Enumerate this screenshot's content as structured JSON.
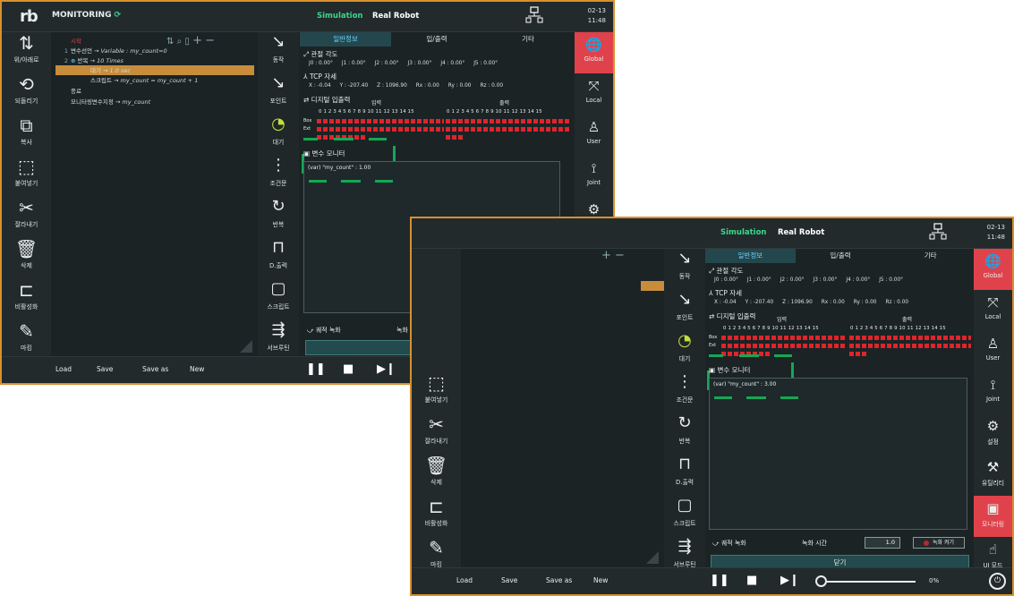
{
  "header": {
    "logo": "rb",
    "title": "MONITORING",
    "mode_sim": "Simulation",
    "mode_real": "Real Robot",
    "date": "02-13",
    "time": "11:48"
  },
  "left_toolbar": [
    {
      "icon": "move-up-down-icon",
      "label": "위/아래로"
    },
    {
      "icon": "restore-icon",
      "label": "되돌리기"
    },
    {
      "icon": "copy-icon",
      "label": "복사"
    },
    {
      "icon": "paste-icon",
      "label": "붙여넣기"
    },
    {
      "icon": "cut-icon",
      "label": "잘라내기"
    },
    {
      "icon": "delete-icon",
      "label": "삭제"
    },
    {
      "icon": "disable-icon",
      "label": "비활성화"
    },
    {
      "icon": "mark-icon",
      "label": "마킹"
    }
  ],
  "program_tree": [
    {
      "num": "",
      "text": "시작"
    },
    {
      "num": "1",
      "text": "변수선언 → ",
      "italic": "Variable : my_count=0"
    },
    {
      "num": "2",
      "text": "반복 → ",
      "italic": "10 Times"
    },
    {
      "num": "",
      "text": "대기 → ",
      "italic": "1.0 sec"
    },
    {
      "num": "",
      "text": "스크립트 → ",
      "italic": "my_count = my_count + 1"
    },
    {
      "num": "",
      "text": "종료"
    },
    {
      "num": "",
      "text": "모니터링변수지정 → ",
      "italic": "my_count"
    }
  ],
  "command_bar": [
    {
      "icon": "move-icon",
      "label": "동작"
    },
    {
      "icon": "point-icon",
      "label": "포인트"
    },
    {
      "icon": "wait-icon",
      "label": "대기"
    },
    {
      "icon": "condition-icon",
      "label": "조건문"
    },
    {
      "icon": "repeat-icon",
      "label": "반복"
    },
    {
      "icon": "digital-out-icon",
      "label": "D.출력"
    },
    {
      "icon": "script-icon",
      "label": "스크립트"
    },
    {
      "icon": "subroutine-icon",
      "label": "서브루틴"
    }
  ],
  "monitor_panel": {
    "tabs": [
      "일반정보",
      "입/출력",
      "기타"
    ],
    "joint_title": "관절 각도",
    "joints": [
      "J0 : 0.00°",
      "J1 : 0.00°",
      "J2 : 0.00°",
      "J3 : 0.00°",
      "J4 : 0.00°",
      "J5 : 0.00°"
    ],
    "tcp_title": "TCP 자세",
    "tcp": [
      "X : -0.04",
      "Y : -207.40",
      "Z : 1096.90",
      "Rx : 0.00",
      "Ry : 0.00",
      "Rz : 0.00"
    ],
    "io_title": "디지털 입출력",
    "io_in": "입력",
    "io_out": "출력",
    "io_numbers": "0 1 2 3 4 5 6 7 8 9 10 11 12 13 14 15",
    "io_box": "Box",
    "io_ext": "Ext",
    "var_monitor_title": "변수 모니터",
    "var_value_w1": "(var) \"my_count\" : 1.00",
    "var_value_w2": "(var) \"my_count\" : 3.00",
    "record_title": "궤적 녹화",
    "record_time_label": "녹화 시간",
    "record_time_value": "1.0",
    "record_button": "녹화 켜기",
    "close_button": "닫기"
  },
  "right_toolbar": [
    {
      "icon": "global-icon",
      "label": "Global"
    },
    {
      "icon": "local-icon",
      "label": "Local"
    },
    {
      "icon": "user-icon",
      "label": "User"
    },
    {
      "icon": "joint-icon",
      "label": "Joint"
    },
    {
      "icon": "settings-icon",
      "label": "설정"
    },
    {
      "icon": "utility-icon",
      "label": "유틸리티"
    },
    {
      "icon": "monitoring-icon",
      "label": "모니터링"
    },
    {
      "icon": "ui-mode-icon",
      "label": "UI 모드"
    }
  ],
  "bottom_bar": {
    "load": "Load",
    "save": "Save",
    "save_as": "Save as",
    "new": "New",
    "progress": "0%",
    "progress_value": 0
  },
  "colors": {
    "accent_orange": "#d9902e",
    "io_red": "#e0242b",
    "sim_green": "#39d88a",
    "active_red": "#e0424b"
  }
}
